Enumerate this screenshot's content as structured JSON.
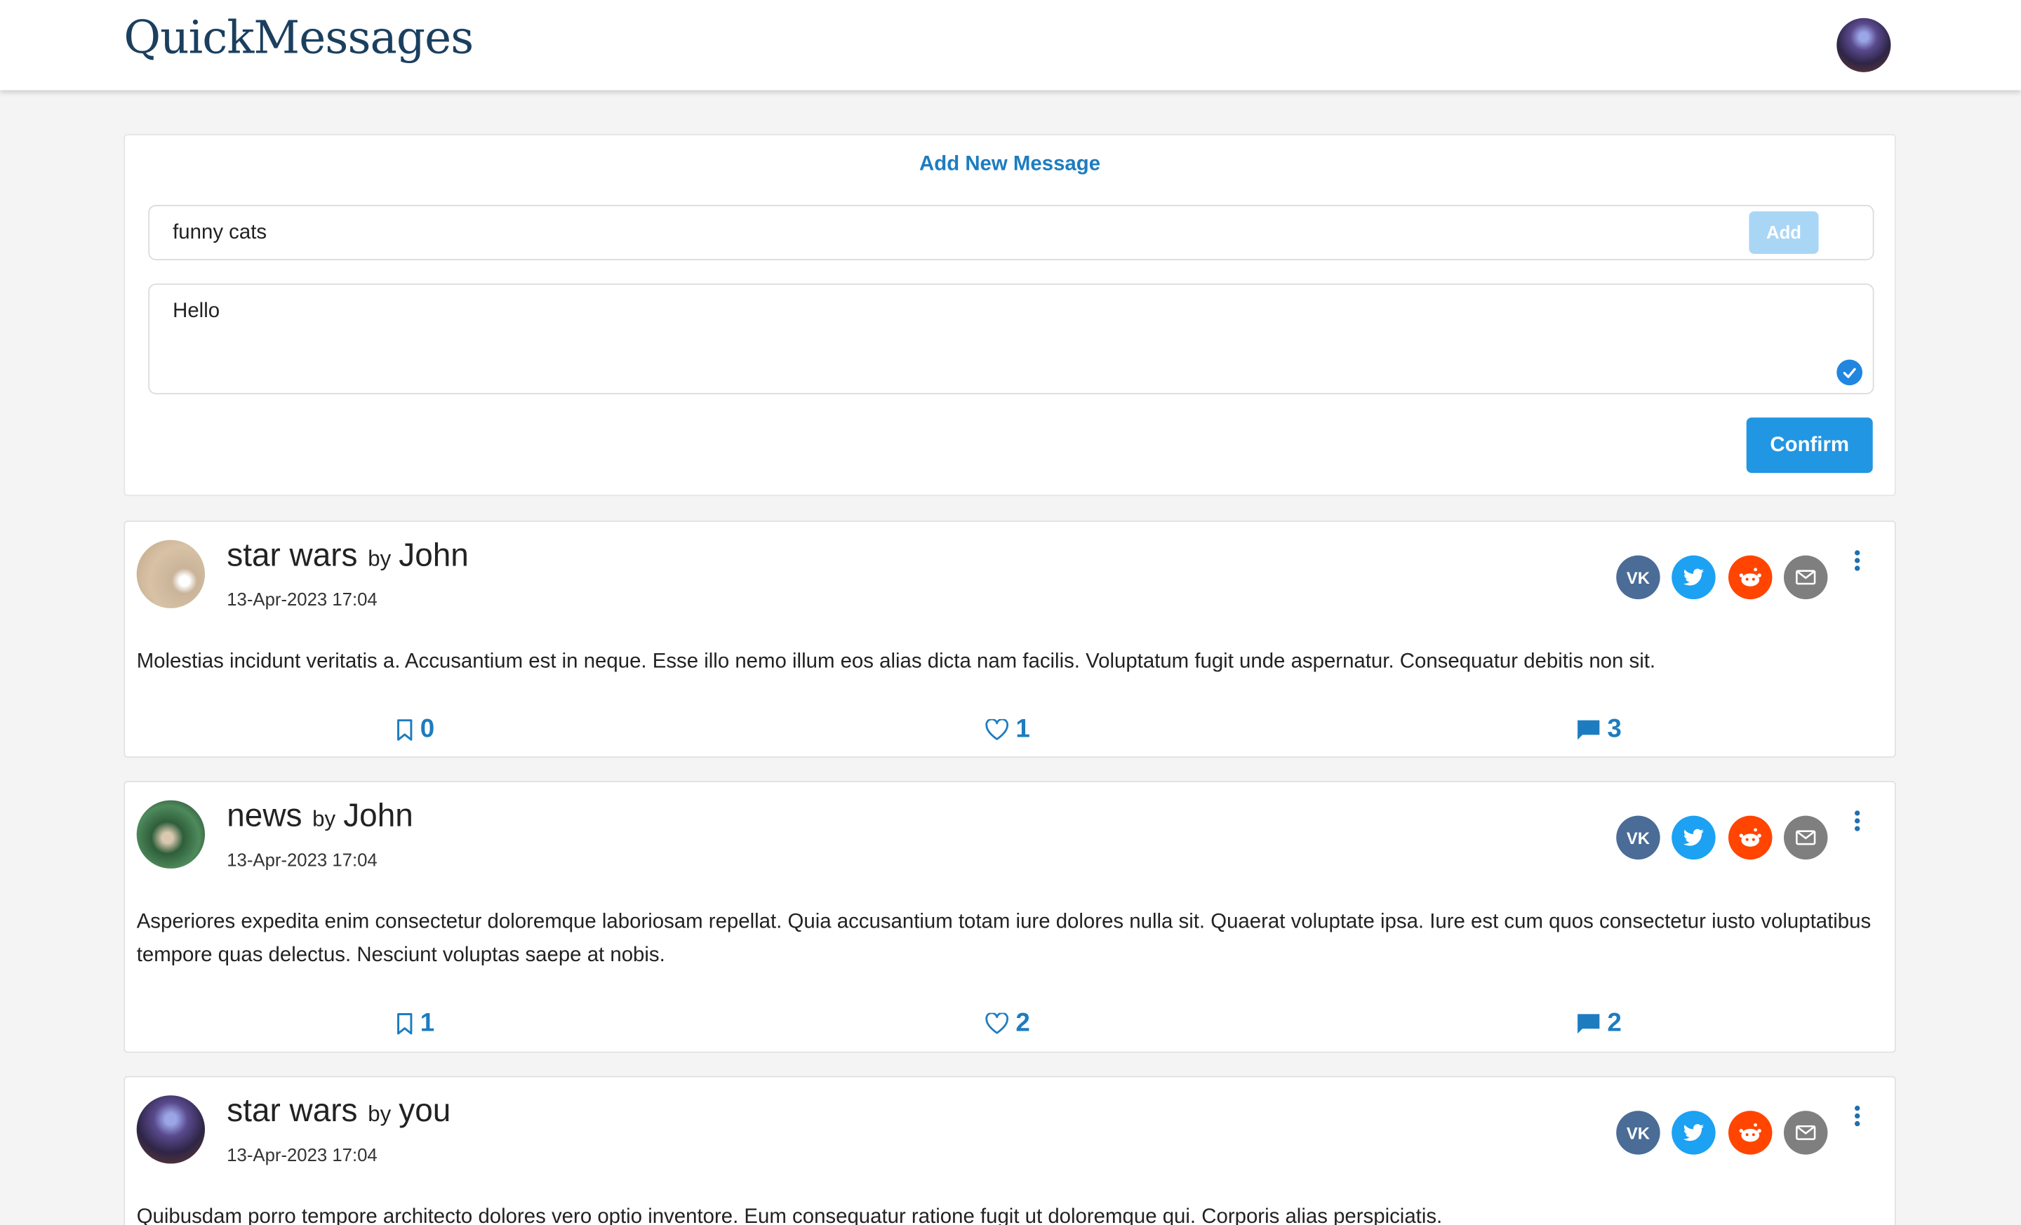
{
  "header": {
    "brand": "QuickMessages",
    "avatar_icon": "user-avatar"
  },
  "composer": {
    "title": "Add New Message",
    "title_value": "funny cats",
    "add_label": "Add",
    "body_value": "Hello",
    "confirm_label": "Confirm"
  },
  "posts": [
    {
      "topic": "star wars",
      "by": "by",
      "author": "John",
      "date": "13-Apr-2023 17:04",
      "text": "Molestias incidunt veritatis a. Accusantium est in neque. Esse illo nemo illum eos alias dicta nam facilis. Voluptatum fugit unde aspernatur. Consequatur debitis non sit.",
      "bookmarks": "0",
      "likes": "1",
      "comments": "3"
    },
    {
      "topic": "news",
      "by": "by",
      "author": "John",
      "date": "13-Apr-2023 17:04",
      "text": "Asperiores expedita enim consectetur doloremque laboriosam repellat. Quia accusantium totam iure dolores nulla sit. Quaerat voluptate ipsa. Iure est cum quos consectetur iusto voluptatibus tempore quas delectus. Nesciunt voluptas saepe at nobis.",
      "bookmarks": "1",
      "likes": "2",
      "comments": "2"
    },
    {
      "topic": "star wars",
      "by": "by",
      "author": "you",
      "date": "13-Apr-2023 17:04",
      "text": "Quibusdam porro tempore architecto dolores vero optio inventore. Eum consequatur ratione fugit ut doloremque qui. Corporis alias perspiciatis."
    }
  ],
  "share_icons": [
    "vk-icon",
    "twitter-icon",
    "reddit-icon",
    "email-icon"
  ],
  "colors": {
    "accent": "#1d7cc0",
    "vk": "#4a6c96",
    "twitter": "#1da1f2",
    "reddit": "#ff4500",
    "email": "#7f7f7f"
  }
}
